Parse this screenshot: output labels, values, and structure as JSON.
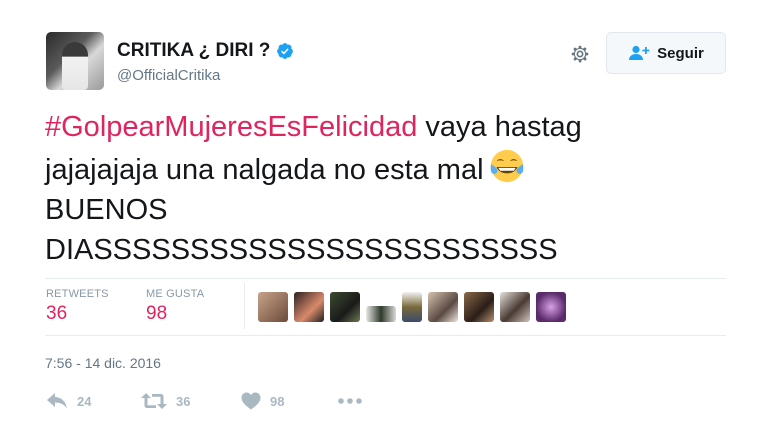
{
  "user": {
    "display_name": "CRITIKA ¿ DIRI ?",
    "handle": "@OfficialCritika",
    "verified": true
  },
  "follow_button": {
    "label": "Seguir"
  },
  "tweet": {
    "hashtag": "#GolpearMujeresEsFelicidad",
    "line1_rest": " vaya hastag",
    "line2": "jajajajaja una nalgada no esta mal",
    "line2_emoji": "face-with-tears-of-joy",
    "line3": "BUENOS",
    "line4": "DIASSSSSSSSSSSSSSSSSSSSSSSS"
  },
  "stats": {
    "retweets_label": "RETWEETS",
    "retweets_value": "36",
    "likes_label": "ME GUSTA",
    "likes_value": "98",
    "liker_count_shown": 9
  },
  "timestamp": "7:56 - 14 dic. 2016",
  "actions": {
    "reply_count": "24",
    "retweet_count": "36",
    "like_count": "98"
  },
  "colors": {
    "hashtag": "#e0245e",
    "stat_value": "#e0245e",
    "secondary_text": "#657786",
    "action_icon": "#aab8c2",
    "verified": "#1da1f2",
    "follow_icon": "#1da1f2"
  }
}
